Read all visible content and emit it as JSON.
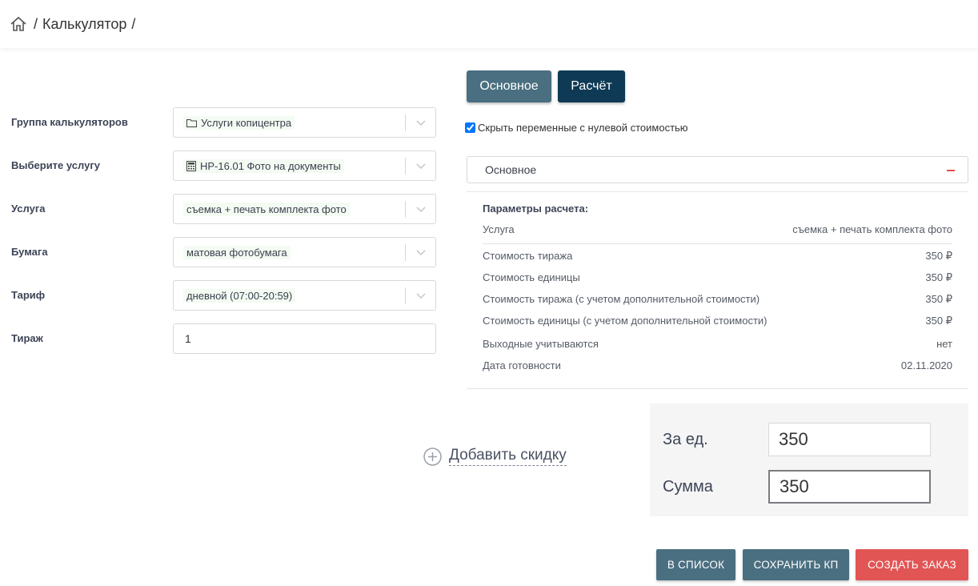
{
  "breadcrumb": {
    "separator": "/",
    "items": [
      "Калькулятор"
    ],
    "trailing": "/"
  },
  "form": {
    "fields": [
      {
        "label": "Группа калькуляторов",
        "value": "Услуги копицентра",
        "icon": "folder-icon"
      },
      {
        "label": "Выберите услугу",
        "value": "НР-16.01 Фото на документы",
        "icon": "calculator-icon"
      },
      {
        "label": "Услуга",
        "value": "съемка + печать комплекта фото"
      },
      {
        "label": "Бумага",
        "value": "матовая фотобумага"
      },
      {
        "label": "Тариф",
        "value": "дневной (07:00-20:59)"
      }
    ],
    "quantity": {
      "label": "Тираж",
      "value": "1"
    }
  },
  "tabs": {
    "main": "Основное",
    "calc": "Расчёт"
  },
  "options": {
    "hide_zero_label": "Скрыть переменные с нулевой стоимостью",
    "hide_zero_checked": true
  },
  "panel": {
    "title": "Основное",
    "params_title": "Параметры расчета:",
    "service_row": {
      "label": "Услуга",
      "value": "съемка + печать комплекта фото"
    },
    "rows": [
      {
        "label": "Стоимость тиража",
        "value": "350 ₽"
      },
      {
        "label": "Стоимость единицы",
        "value": "350 ₽"
      },
      {
        "label": "Стоимость тиража (с учетом дополнительной стоимости)",
        "value": "350 ₽"
      },
      {
        "label": "Стоимость единицы (с учетом дополнительной стоимости)",
        "value": "350 ₽"
      },
      {
        "label": "Выходные учитываются",
        "value": "нет"
      },
      {
        "label": "Дата готовности",
        "value": "02.11.2020"
      }
    ]
  },
  "discount": {
    "label": "Добавить скидку"
  },
  "totals": {
    "per_unit_label": "За ед.",
    "per_unit_value": "350",
    "sum_label": "Сумма",
    "sum_value": "350"
  },
  "actions": {
    "to_list": "В СПИСОК",
    "save_kp": "СОХРАНИТЬ КП",
    "create_order": "СОЗДАТЬ ЗАКАЗ"
  },
  "colors": {
    "primary": "#4a6f80",
    "dark": "#0e3a55",
    "danger": "#e25555"
  }
}
